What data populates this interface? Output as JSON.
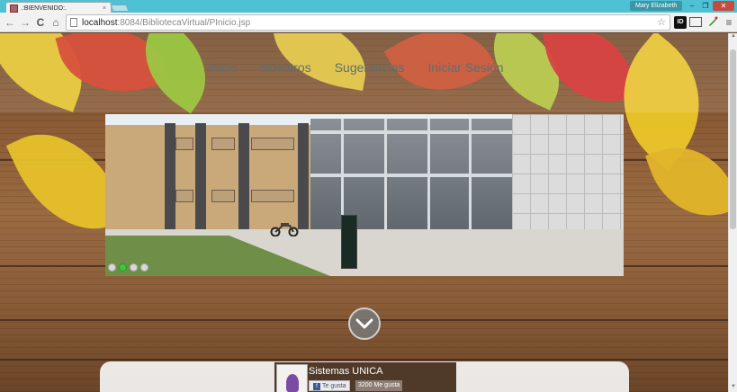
{
  "browser": {
    "tab_title": ".:BIENVENIDO:.",
    "tab_close": "×",
    "user_name": "Mary Elizabeth",
    "window": {
      "minimize": "–",
      "maximize": "❐",
      "close": "✕"
    },
    "nav": {
      "back": "←",
      "forward": "→",
      "reload": "C",
      "home": "⌂"
    },
    "url_host": "localhost",
    "url_rest": ":8084/BibliotecaVirtual/PInicio.jsp",
    "star": "☆",
    "ext_id_label": "ID",
    "menu": "≡"
  },
  "page": {
    "nav_links": [
      "Inicio",
      "Nosotros",
      "Sugerencias",
      "Iniciar Sesión"
    ],
    "slider": {
      "active_index": 1,
      "dot_count": 4
    },
    "facebook": {
      "page_name": "Sistemas UNICA",
      "like_label": "Te gusta",
      "like_count": "3200 Me gusta"
    }
  },
  "colors": {
    "title_bar": "#4fc1d4",
    "active_dot": "#3ec43e",
    "nav_text": "#5f6f6f"
  }
}
